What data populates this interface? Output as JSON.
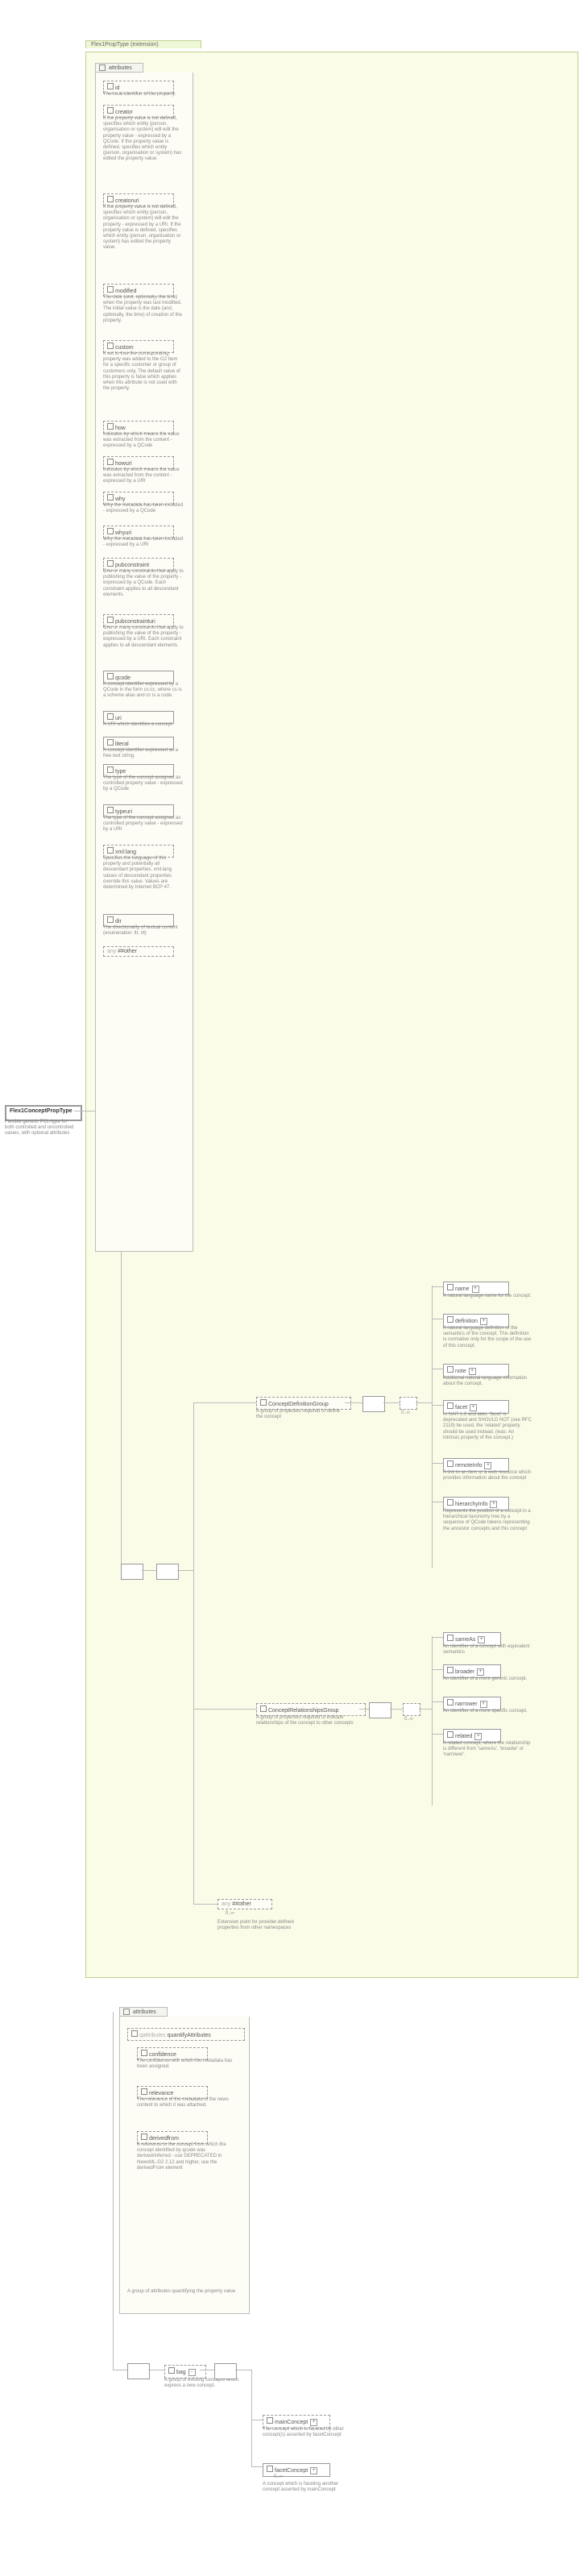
{
  "root": {
    "name": "Flex1ConceptPropType",
    "desc": "Flexible generic PCL-type for both controlled and uncontrolled values, with optional attributes"
  },
  "ext_title": "Flex1PropType (extension)",
  "attr_hdr": "attributes",
  "any_label": "##other",
  "any_prefix": "any",
  "attrs": [
    {
      "n": "id",
      "d": "The local identifier of the property."
    },
    {
      "n": "creator",
      "d": "If the property value is not defined, specifies which entity (person, organisation or system) will edit the property value - expressed by a QCode. If the property value is defined, specifies which entity (person, organisation or system) has edited the property value."
    },
    {
      "n": "creatoruri",
      "d": "If the property value is not defined, specifies which entity (person, organisation or system) will edit the property - expressed by a URI. If the property value is defined, specifies which entity (person, organisation or system) has edited the property value."
    },
    {
      "n": "modified",
      "d": "The date (and, optionally, the time) when the property was last modified. The initial value is the date (and, optionally, the time) of creation of the property."
    },
    {
      "n": "custom",
      "d": "If set to true the corresponding property was added to the G2 Item for a specific customer or group of customers only. The default value of this property is false which applies when this attribute is not used with the property."
    },
    {
      "n": "how",
      "d": "Indicates by which means the value was extracted from the content - expressed by a QCode"
    },
    {
      "n": "howuri",
      "d": "Indicates by which means the value was extracted from the content - expressed by a URI"
    },
    {
      "n": "why",
      "d": "Why the metadata has been included - expressed by a QCode"
    },
    {
      "n": "whyuri",
      "d": "Why the metadata has been included - expressed by a URI"
    },
    {
      "n": "pubconstraint",
      "d": "One or many constraints that apply to publishing the value of the property - expressed by a QCode. Each constraint applies to all descendant elements."
    },
    {
      "n": "pubconstrainturi",
      "d": "One or many constraints that apply to publishing the value of the property - expressed by a URI. Each constraint applies to all descendant elements."
    },
    {
      "n": "qcode",
      "d": "A concept identifier expressed by a QCode in the form cs:cc, where cs is a scheme alias and cc is a code."
    },
    {
      "n": "uri",
      "d": "A URI which identifies a concept."
    },
    {
      "n": "literal",
      "d": "A concept identifier expressed as a free text string."
    },
    {
      "n": "type",
      "d": "The type of the concept assigned as controlled property value - expressed by a QCode"
    },
    {
      "n": "typeuri",
      "d": "The type of the concept assigned as controlled property value - expressed by a URI"
    },
    {
      "n": "xml:lang",
      "d": "Specifies the language of this property and potentially all descendant properties. xml:lang values of descendant properties override this value. Values are determined by Internet BCP 47."
    },
    {
      "n": "dir",
      "d": "The directionality of textual content (enumeration: ltr, rtl)"
    }
  ],
  "cdg": {
    "name": "ConceptDefinitionGroup",
    "desc": "A group of properties required to define the concept"
  },
  "cdg_items": [
    {
      "n": "name",
      "d": "A natural language name for the concept."
    },
    {
      "n": "definition",
      "d": "A natural language definition of the semantics of the concept. This definition is normative only for the scope of the use of this concept."
    },
    {
      "n": "note",
      "d": "Additional natural language information about the concept."
    },
    {
      "n": "facet",
      "d": "In NAR 1.8 and later, 'facet' is deprecated and SHOULD NOT (see RFC 2119) be used, the 'related' property should be used instead. (was: An intrinsic property of the concept.)"
    },
    {
      "n": "remoteInfo",
      "d": "A link to an item or a web resource which provides information about the concept"
    },
    {
      "n": "hierarchyInfo",
      "d": "Represents the position of a concept in a hierarchical taxonomy tree by a sequence of QCode tokens representing the ancestor concepts and this concept"
    }
  ],
  "crg": {
    "name": "ConceptRelationshipsGroup",
    "desc": "A group of properties required to indicate relationships of the concept to other concepts"
  },
  "crg_items": [
    {
      "n": "sameAs",
      "d": "An identifier of a concept with equivalent semantics"
    },
    {
      "n": "broader",
      "d": "An identifier of a more generic concept."
    },
    {
      "n": "narrower",
      "d": "An identifier of a more specific concept."
    },
    {
      "n": "related",
      "d": "A related concept, where the relationship is different from 'sameAs', 'broader' or 'narrower'."
    }
  ],
  "ext_desc": "Extension point for provider-defined properties from other namespaces",
  "qa": {
    "title": "quantifyAttributes",
    "hdr": "qattributes",
    "items": [
      {
        "n": "confidence",
        "d": "The confidence with which the metadata has been assigned."
      },
      {
        "n": "relevance",
        "d": "The relevance of the metadata to the news content to which it was attached."
      },
      {
        "n": "derivedfrom",
        "d": "A reference to the concept from which the concept identified by qcode was derived/inferred - use DEPRECATED in NewsML-G2 2.12 and higher, use the derivedFrom element"
      }
    ],
    "desc": "A group of attributes quantifying the property value"
  },
  "bag": {
    "name": "bag",
    "desc": "A group of existing concepts which express a new concept."
  },
  "bag_items": [
    {
      "n": "mainConcept",
      "d": "The concept which is faceted by other concept(s) asserted by facetConcept"
    },
    {
      "n": "facetConcept",
      "d": "A concept which is faceting another concept asserted by mainConcept",
      "card": "0..∞"
    }
  ],
  "zero_inf": "0..∞"
}
